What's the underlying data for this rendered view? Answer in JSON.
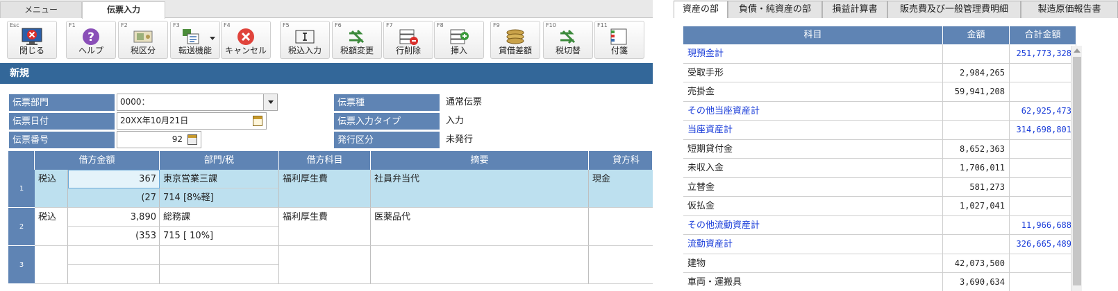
{
  "left": {
    "tabs": [
      {
        "label": "メニュー",
        "active": false
      },
      {
        "label": "伝票入力",
        "active": true
      }
    ],
    "toolbar": [
      {
        "key": "Esc",
        "label": "閉じる",
        "icon": "monitor-close-icon"
      },
      {
        "key": "F1",
        "label": "ヘルプ",
        "icon": "help-icon"
      },
      {
        "key": "F2",
        "label": "税区分",
        "icon": "money-icon"
      },
      {
        "key": "F3",
        "label": "転送機能",
        "icon": "transfer-icon"
      },
      {
        "key": "F4",
        "label": "キャンセル",
        "icon": "cancel-icon"
      },
      {
        "key": "F5",
        "label": "税込入力",
        "icon": "text-cursor-icon"
      },
      {
        "key": "F6",
        "label": "税額変更",
        "icon": "swap-icon"
      },
      {
        "key": "F7",
        "label": "行削除",
        "icon": "row-delete-icon"
      },
      {
        "key": "F8",
        "label": "挿入",
        "icon": "row-insert-icon"
      },
      {
        "key": "F9",
        "label": "貸借差額",
        "icon": "balance-icon"
      },
      {
        "key": "F10",
        "label": "税切替",
        "icon": "swap-icon"
      },
      {
        "key": "F11",
        "label": "付箋",
        "icon": "sticky-note-icon"
      }
    ],
    "title": "新規",
    "form": {
      "dept_label": "伝票部門",
      "dept_value": "0000：",
      "date_label": "伝票日付",
      "date_value": "20XX年10月21日",
      "number_label": "伝票番号",
      "number_value": "92",
      "type_label": "伝票種",
      "type_value": "通常伝票",
      "input_type_label": "伝票入力タイプ",
      "input_type_value": "入力",
      "issue_label": "発行区分",
      "issue_value": "未発行"
    },
    "grid": {
      "headers": [
        "借方金額",
        "部門/税",
        "借方科目",
        "摘要",
        "貸方科"
      ],
      "rows": [
        {
          "num": "1",
          "tax": "税込",
          "amount": "367",
          "sub_amount": "(27",
          "dept": "東京営業三課",
          "dept_tax": "714 [8%軽]",
          "account": "福利厚生費",
          "memo": "社員弁当代",
          "credit": "現金"
        },
        {
          "num": "2",
          "tax": "税込",
          "amount": "3,890",
          "sub_amount": "(353",
          "dept": "総務課",
          "dept_tax": "715 [ 10%]",
          "account": "福利厚生費",
          "memo": "医薬品代",
          "credit": ""
        },
        {
          "num": "3",
          "tax": "",
          "amount": "",
          "sub_amount": "",
          "dept": "",
          "dept_tax": "",
          "account": "",
          "memo": "",
          "credit": ""
        }
      ]
    }
  },
  "right": {
    "tabs": [
      {
        "label": "資産の部",
        "active": true
      },
      {
        "label": "負債・純資産の部",
        "active": false
      },
      {
        "label": "損益計算書",
        "active": false
      },
      {
        "label": "販売費及び一般管理費明細",
        "active": false
      },
      {
        "label": "製造原価報告書",
        "active": false
      }
    ],
    "headers": [
      "科目",
      "金額",
      "合計金額"
    ],
    "rows": [
      {
        "name": "現預金計",
        "amount": "",
        "total": "251,773,328",
        "subtotal": true
      },
      {
        "name": "受取手形",
        "amount": "2,984,265",
        "total": "",
        "subtotal": false
      },
      {
        "name": "売掛金",
        "amount": "59,941,208",
        "total": "",
        "subtotal": false
      },
      {
        "name": "その他当座資産計",
        "amount": "",
        "total": "62,925,473",
        "subtotal": true
      },
      {
        "name": "当座資産計",
        "amount": "",
        "total": "314,698,801",
        "subtotal": true
      },
      {
        "name": "短期貸付金",
        "amount": "8,652,363",
        "total": "",
        "subtotal": false
      },
      {
        "name": "未収入金",
        "amount": "1,706,011",
        "total": "",
        "subtotal": false
      },
      {
        "name": "立替金",
        "amount": "581,273",
        "total": "",
        "subtotal": false
      },
      {
        "name": "仮払金",
        "amount": "1,027,041",
        "total": "",
        "subtotal": false
      },
      {
        "name": "その他流動資産計",
        "amount": "",
        "total": "11,966,688",
        "subtotal": true
      },
      {
        "name": "流動資産計",
        "amount": "",
        "total": "326,665,489",
        "subtotal": true
      },
      {
        "name": "建物",
        "amount": "42,073,500",
        "total": "",
        "subtotal": false
      },
      {
        "name": "車両・運搬具",
        "amount": "3,690,634",
        "total": "",
        "subtotal": false
      }
    ]
  }
}
